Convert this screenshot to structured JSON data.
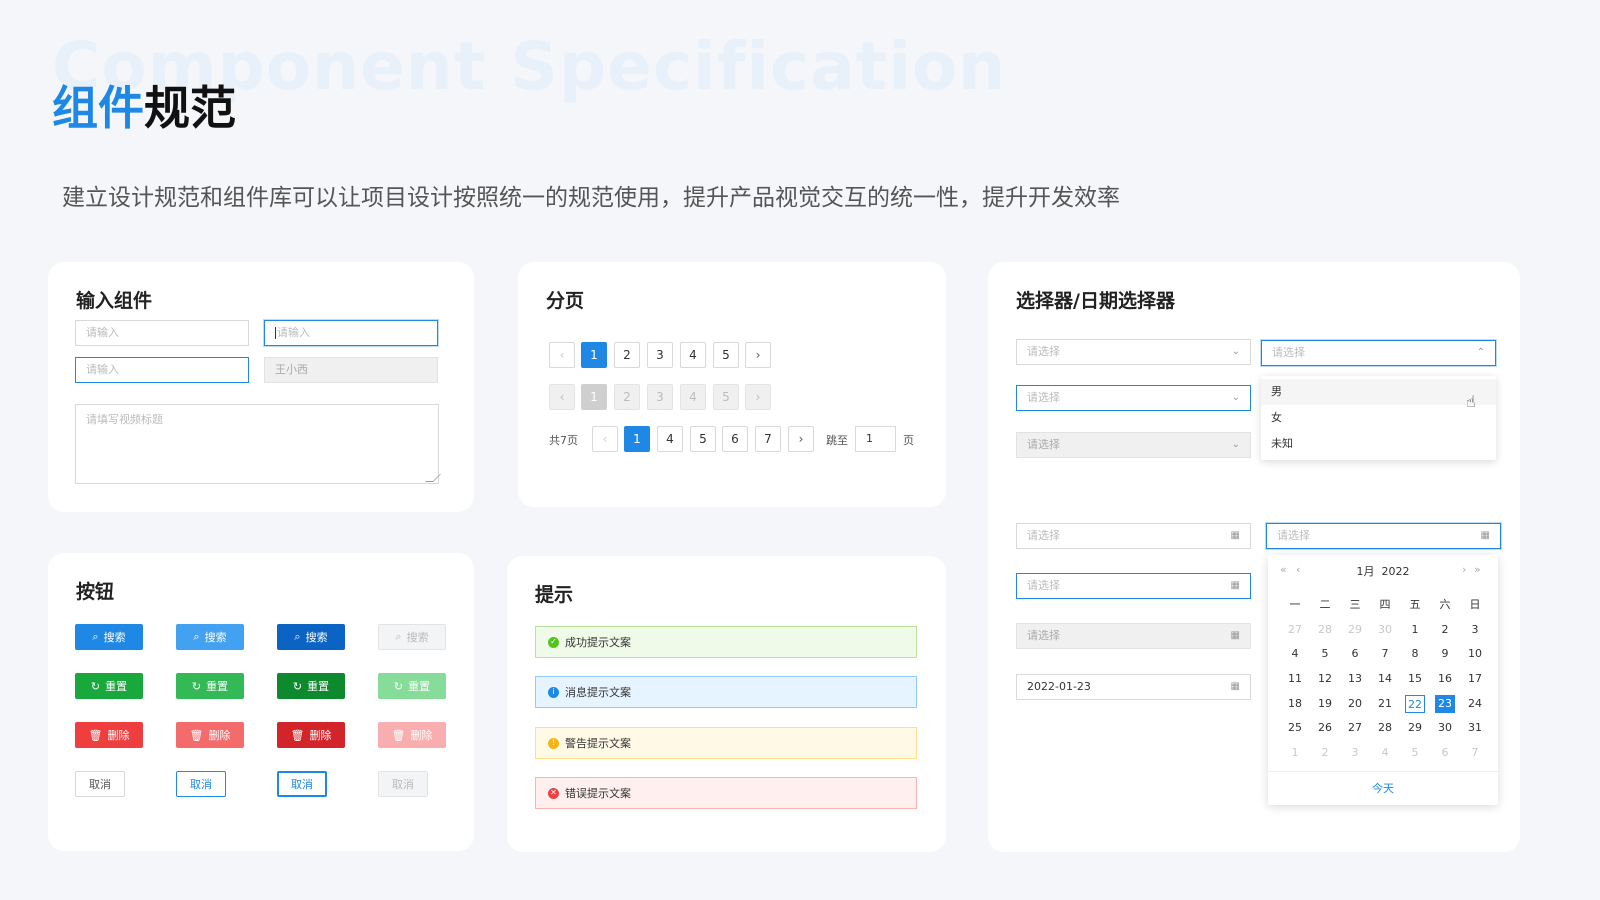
{
  "header": {
    "bg_title": "Component Specification",
    "title_highlight": "组件",
    "title_rest": "规范",
    "subtitle": "建立设计规范和组件库可以让项目设计按照统一的规范使用，提升产品视觉交互的统一性，提升开发效率"
  },
  "input_card": {
    "title": "输入组件",
    "placeholder": "请输入",
    "disabled_value": "王小西",
    "textarea_placeholder": "请填写视频标题"
  },
  "pagination_card": {
    "title": "分页",
    "pages": [
      "1",
      "2",
      "3",
      "4",
      "5"
    ],
    "prev_icon": "‹",
    "next_icon": "›",
    "total_label": "共7页",
    "pages_full": [
      "1",
      "4",
      "5",
      "6",
      "7"
    ],
    "jump_label": "跳至",
    "jump_value": "1",
    "page_unit": "页",
    "current_page": 1
  },
  "selector_card": {
    "title": "选择器/日期选择器",
    "select_placeholder": "请选择",
    "options": [
      "男",
      "女",
      "未知"
    ],
    "date_value": "2022-01-23"
  },
  "calendar": {
    "month_label": "1月",
    "year_label": "2022",
    "weekdays": [
      "一",
      "二",
      "三",
      "四",
      "五",
      "六",
      "日"
    ],
    "days": [
      "27",
      "28",
      "29",
      "30",
      "1",
      "2",
      "3",
      "4",
      "5",
      "6",
      "7",
      "8",
      "9",
      "10",
      "11",
      "12",
      "13",
      "14",
      "15",
      "16",
      "17",
      "18",
      "19",
      "20",
      "21",
      "22",
      "23",
      "24",
      "25",
      "26",
      "27",
      "28",
      "29",
      "30",
      "31",
      "1",
      "2",
      "3",
      "4",
      "5",
      "6",
      "7"
    ],
    "today_day": "22",
    "selected_day": "23",
    "today_button": "今天"
  },
  "button_card": {
    "title": "按钮",
    "search_label": "搜索",
    "reset_label": "重置",
    "delete_label": "删除",
    "cancel_label": "取消"
  },
  "alert_card": {
    "title": "提示",
    "success": "成功提示文案",
    "info": "消息提示文案",
    "warning": "警告提示文案",
    "error": "错误提示文案"
  },
  "colors": {
    "primary": "#1f88e5",
    "success": "#19a83b",
    "danger": "#ef3e3e",
    "warning": "#f5b316"
  }
}
